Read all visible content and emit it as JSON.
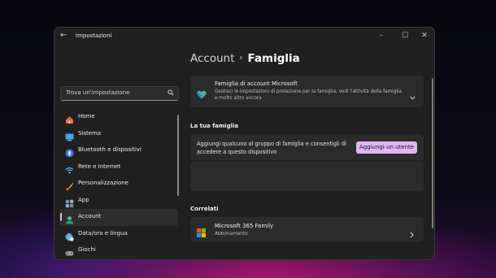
{
  "window": {
    "title": "Impostazioni",
    "minimize": "–",
    "maximize": "☐",
    "close": "✕",
    "back": "←"
  },
  "breadcrumb": {
    "parent": "Account",
    "separator": "›",
    "current": "Famiglia"
  },
  "search": {
    "placeholder": "Trova un'impostazione"
  },
  "sidebar": {
    "items": [
      {
        "label": "Home",
        "icon": "home-icon",
        "color": "#e86a3c"
      },
      {
        "label": "Sistema",
        "icon": "system-icon",
        "color": "#4aa3e8"
      },
      {
        "label": "Bluetooth e dispositivi",
        "icon": "bluetooth-icon",
        "color": "#2f7fd6"
      },
      {
        "label": "Rete e Internet",
        "icon": "wifi-icon",
        "color": "#5ab3f0"
      },
      {
        "label": "Personalizzazione",
        "icon": "brush-icon",
        "color": "#e4a24c"
      },
      {
        "label": "App",
        "icon": "apps-icon",
        "color": "#7c8ea4"
      },
      {
        "label": "Account",
        "icon": "account-icon",
        "color": "#4fc08d"
      },
      {
        "label": "Data/ora e lingua",
        "icon": "globe-clock-icon",
        "color": "#3d9ad8"
      },
      {
        "label": "Giochi",
        "icon": "gamepad-icon",
        "color": "#a0a0a0"
      }
    ],
    "active_index": 6
  },
  "family_account": {
    "title": "Famiglia di account Microsoft",
    "description": "Gestisci le impostazioni di protezione per la famiglia, vedi l'attività della famiglia e molto altro ancora"
  },
  "your_family": {
    "heading": "La tua famiglia",
    "text": "Aggiungi qualcuno al gruppo di famiglia e consentigli di accedere a questo dispositivo",
    "button": "Aggiungi un utente"
  },
  "related": {
    "heading": "Correlati",
    "item_title": "Microsoft 365 Family",
    "item_subtitle": "Abbonamento"
  },
  "colors": {
    "accent": "#e0b6f2",
    "window_bg": "#202020",
    "card_bg": "#2b2b2b"
  }
}
